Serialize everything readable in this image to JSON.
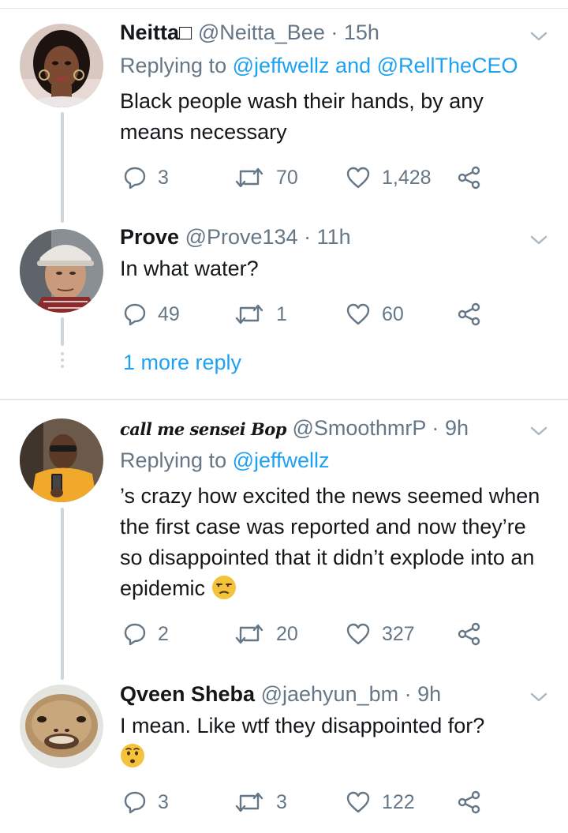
{
  "tweets": [
    {
      "name": "Neitta□",
      "handle": "@Neitta_Bee",
      "sep": "·",
      "time": "15h",
      "replying_prefix": "Replying to ",
      "replying_1": "@jeffwellz",
      "replying_and": " and ",
      "replying_2": "@RellTheCEO",
      "text": "Black people wash their hands, by any means necessary",
      "replies": "3",
      "retweets": "70",
      "likes": "1,428"
    },
    {
      "name": "Prove",
      "handle": "@Prove134",
      "sep": "·",
      "time": "11h",
      "text": "In what water?",
      "replies": "49",
      "retweets": "1",
      "likes": "60"
    },
    {
      "name": "call me sensei Bop",
      "handle": "@SmoothmrP",
      "sep": "·",
      "time": "9h",
      "replying_prefix": "Replying to ",
      "replying_1": "@jeffwellz",
      "text": "’s crazy how excited the news seemed when the first case was reported and now they’re so disappointed that it didn’t explode into an epidemic",
      "emoji": "unamused-face",
      "replies": "2",
      "retweets": "20",
      "likes": "327"
    },
    {
      "name": "Qveen Sheba",
      "handle": "@jaehyun_bm",
      "sep": "·",
      "time": "9h",
      "text": "I mean. Like wtf they disappointed for?",
      "emoji": "hushed-face",
      "replies": "3",
      "retweets": "3",
      "likes": "122"
    }
  ],
  "more_replies": "1 more reply",
  "colors": {
    "accent": "#1da1f2",
    "secondary_text": "#657786",
    "primary_text": "#14171a",
    "divider": "#e1e8ed",
    "thread_line": "#cdd6dd"
  },
  "icons": [
    "reply-icon",
    "retweet-icon",
    "like-icon",
    "share-icon",
    "chevron-down-icon"
  ]
}
